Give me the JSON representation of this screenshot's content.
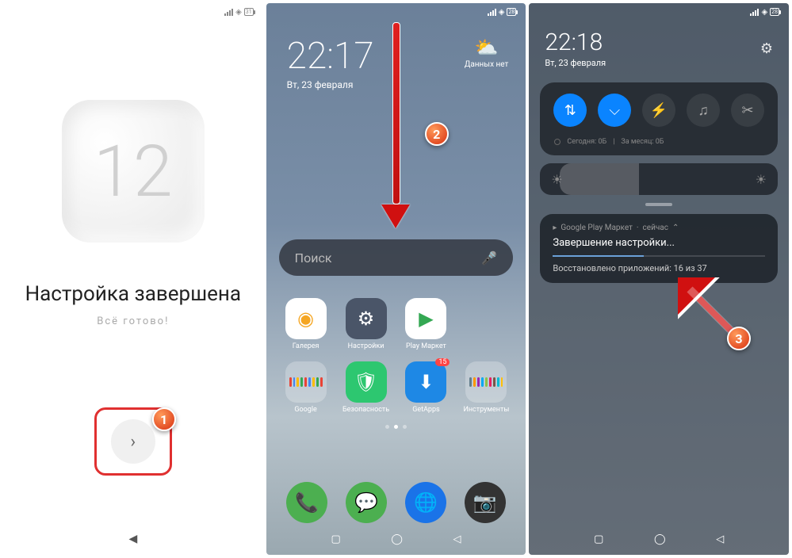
{
  "screen1": {
    "statusbar": {
      "battery": "31"
    },
    "title": "Настройка завершена",
    "subtitle": "Всё готово!",
    "logo_text": "12",
    "callout": "1"
  },
  "screen2": {
    "statusbar": {
      "battery": "28"
    },
    "clock": {
      "time": "22:17",
      "date": "Вт, 23 февраля"
    },
    "weather": {
      "label": "Данных нет"
    },
    "search_placeholder": "Поиск",
    "apps": {
      "gallery": "Галерея",
      "settings": "Настройки",
      "play": "Play Маркет",
      "google": "Google",
      "security": "Безопасность",
      "getapps": "GetApps",
      "getapps_badge": "15",
      "tools": "Инструменты"
    },
    "callout": "2"
  },
  "screen3": {
    "statusbar": {
      "battery": "28"
    },
    "clock": {
      "time": "22:18",
      "date": "Вт, 23 февраля"
    },
    "usage": {
      "today": "Сегодня: 0Б",
      "month": "За месяц: 0Б"
    },
    "notification": {
      "source": "Google Play Маркет",
      "when": "сейчас",
      "title": "Завершение настройки...",
      "subtitle": "Восстановлено приложений: 16 из 37"
    },
    "callout": "3"
  }
}
